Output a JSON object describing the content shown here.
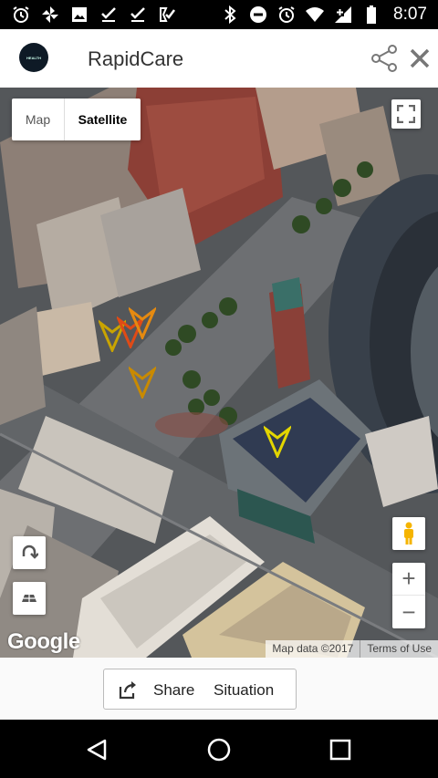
{
  "status_bar": {
    "time": "8:07",
    "left_icons": [
      "alarm-icon",
      "pinwheel-icon",
      "photo-icon",
      "check-icon",
      "check-icon",
      "check-alt-icon"
    ],
    "right_icons": [
      "bluetooth-icon",
      "dnd-icon",
      "alarm-icon",
      "wifi-icon",
      "signal-plus-icon",
      "battery-icon"
    ]
  },
  "app_bar": {
    "logo_text": "HEALTH",
    "title": "RapidCare"
  },
  "map": {
    "type_map_label": "Map",
    "type_satellite_label": "Satellite",
    "selected_type": "Satellite",
    "google_logo": "Google",
    "map_data_label": "Map data ©2017",
    "terms_label": "Terms of Use",
    "zoom_in": "+",
    "zoom_out": "−",
    "marker_colors": [
      "#c9a400",
      "#e04a16",
      "#e58a10",
      "#c98a00",
      "#e3d600"
    ]
  },
  "footer": {
    "share_label": "Share",
    "situation_label": "Situation"
  },
  "colors": {
    "accent": "#333333",
    "status_bar": "#000000",
    "app_bar": "#ffffff"
  }
}
